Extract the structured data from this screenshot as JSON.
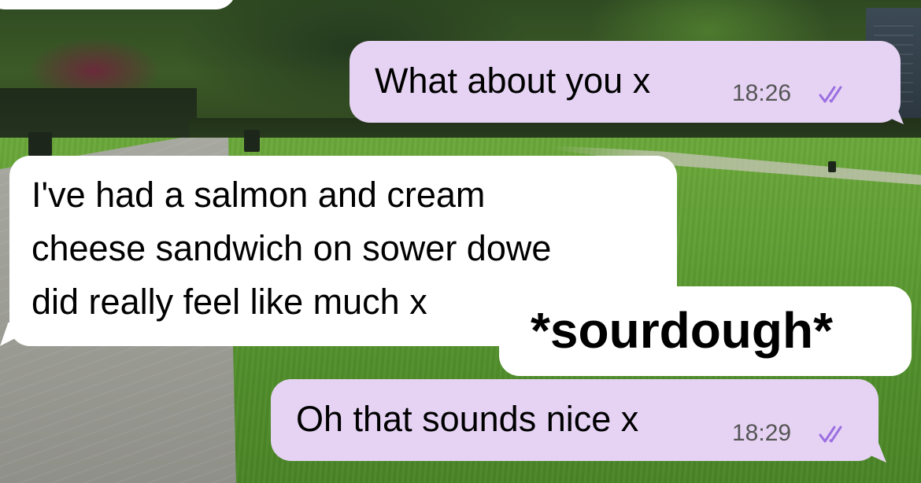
{
  "messages": [
    {
      "direction": "outgoing",
      "text": "What about you x",
      "time": "18:26",
      "status_icon": "double-check-icon"
    },
    {
      "direction": "incoming",
      "lines": [
        "I've had a salmon and cream",
        "cheese sandwich on sower dowe",
        "did really feel like much x"
      ]
    },
    {
      "direction": "incoming",
      "text": "*sourdough*"
    },
    {
      "direction": "outgoing",
      "text": "Oh that sounds nice x",
      "time": "18:29",
      "status_icon": "double-check-icon"
    }
  ],
  "colors": {
    "outgoing_bubble": "#e6d3f4",
    "incoming_bubble": "#ffffff",
    "read_tick": "#9b6fe0",
    "timestamp": "#555555"
  },
  "wallpaper": "park-lawn-photo"
}
